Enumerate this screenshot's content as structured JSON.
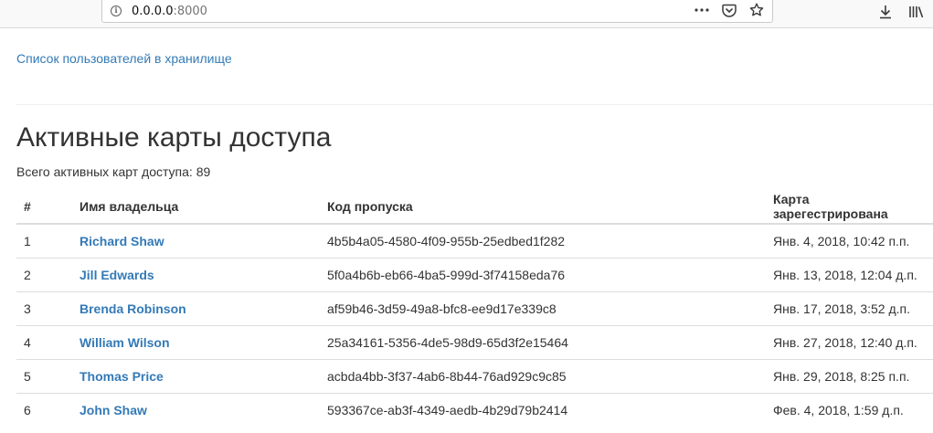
{
  "browser": {
    "url_host": "0.0.0.0",
    "url_port": ":8000"
  },
  "nav": {
    "users_link": "Список пользователей в хранилище"
  },
  "page": {
    "title": "Активные карты доступа",
    "total_label": "Всего активных карт доступа: 89"
  },
  "table": {
    "headers": {
      "num": "#",
      "owner": "Имя владельца",
      "code": "Код пропуска",
      "registered": "Карта зарегестрирована"
    },
    "rows": [
      {
        "num": "1",
        "owner": "Richard Shaw",
        "code": "4b5b4a05-4580-4f09-955b-25edbed1f282",
        "registered": "Янв. 4, 2018, 10:42 п.п."
      },
      {
        "num": "2",
        "owner": "Jill Edwards",
        "code": "5f0a4b6b-eb66-4ba5-999d-3f74158eda76",
        "registered": "Янв. 13, 2018, 12:04 д.п."
      },
      {
        "num": "3",
        "owner": "Brenda Robinson",
        "code": "af59b46-3d59-49a8-bfc8-ee9d17e339c8",
        "registered": "Янв. 17, 2018, 3:52 д.п."
      },
      {
        "num": "4",
        "owner": "William Wilson",
        "code": "25a34161-5356-4de5-98d9-65d3f2e15464",
        "registered": "Янв. 27, 2018, 12:40 д.п."
      },
      {
        "num": "5",
        "owner": "Thomas Price",
        "code": "acbda4bb-3f37-4ab6-8b44-76ad929c9c85",
        "registered": "Янв. 29, 2018, 8:25 п.п."
      },
      {
        "num": "6",
        "owner": "John Shaw",
        "code": "593367ce-ab3f-4349-aedb-4b29d79b2414",
        "registered": "Фев. 4, 2018, 1:59 д.п."
      }
    ]
  }
}
